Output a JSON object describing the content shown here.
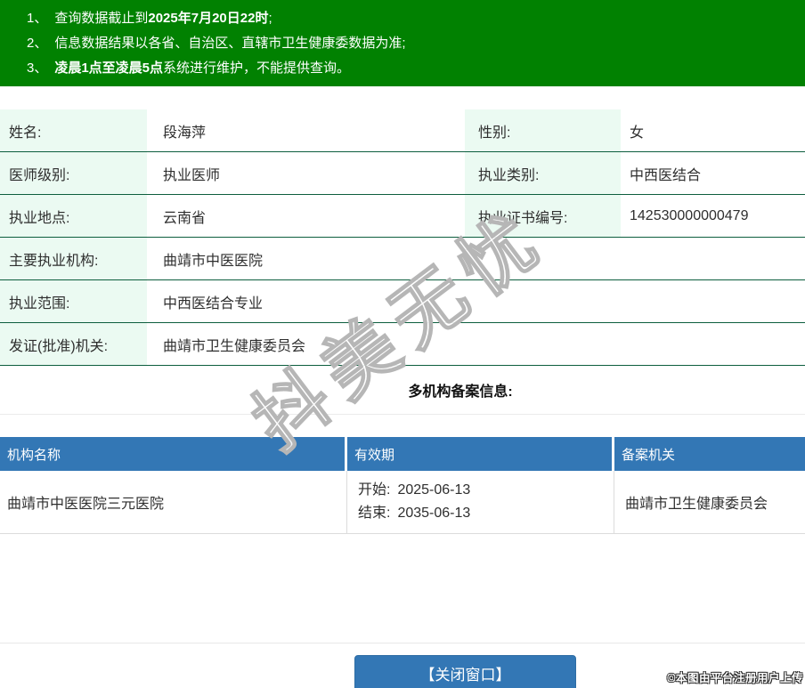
{
  "banner": {
    "lines": [
      {
        "num": "1、",
        "pre": "查询数据截止到",
        "bold": "2025年7月20日22时",
        "post": ";"
      },
      {
        "num": "2、",
        "pre": "信息数据结果以各省、自治区、直辖市卫生健康委数据为准;",
        "bold": "",
        "post": ""
      },
      {
        "num": "3、",
        "pre": "",
        "bold": "凌晨1点至凌晨5点",
        "post": "系统进行维护，不能提供查询。"
      }
    ]
  },
  "details": {
    "name_label": "姓名:",
    "name": "段海萍",
    "gender_label": "性别:",
    "gender": "女",
    "level_label": "医师级别:",
    "level": "执业医师",
    "category_label": "执业类别:",
    "category": "中西医结合",
    "location_label": "执业地点:",
    "location": "云南省",
    "cert_no_label": "执业证书编号:",
    "cert_no": "142530000000479",
    "main_org_label": "主要执业机构:",
    "main_org": "曲靖市中医医院",
    "scope_label": "执业范围:",
    "scope": "中西医结合专业",
    "issuer_label": "发证(批准)机关:",
    "issuer": "曲靖市卫生健康委员会"
  },
  "multi_org": {
    "section_title": "多机构备案信息:",
    "headers": [
      "机构名称",
      "有效期",
      "备案机关"
    ],
    "rows": [
      {
        "org_name": "曲靖市中医医院三元医院",
        "start_label": "开始:",
        "start_date": "2025-06-13",
        "end_label": "结束:",
        "end_date": "2035-06-13",
        "authority": "曲靖市卫生健康委员会"
      }
    ]
  },
  "footer": {
    "close_button": "【关闭窗口】",
    "copyright": "©本图由平台注册用户上传"
  },
  "watermark": "抖美无忧",
  "colors": {
    "banner_green": "#018101",
    "label_bg": "#ebfaf2",
    "row_border": "#0d5e3e",
    "accent_blue": "#3377b5"
  }
}
